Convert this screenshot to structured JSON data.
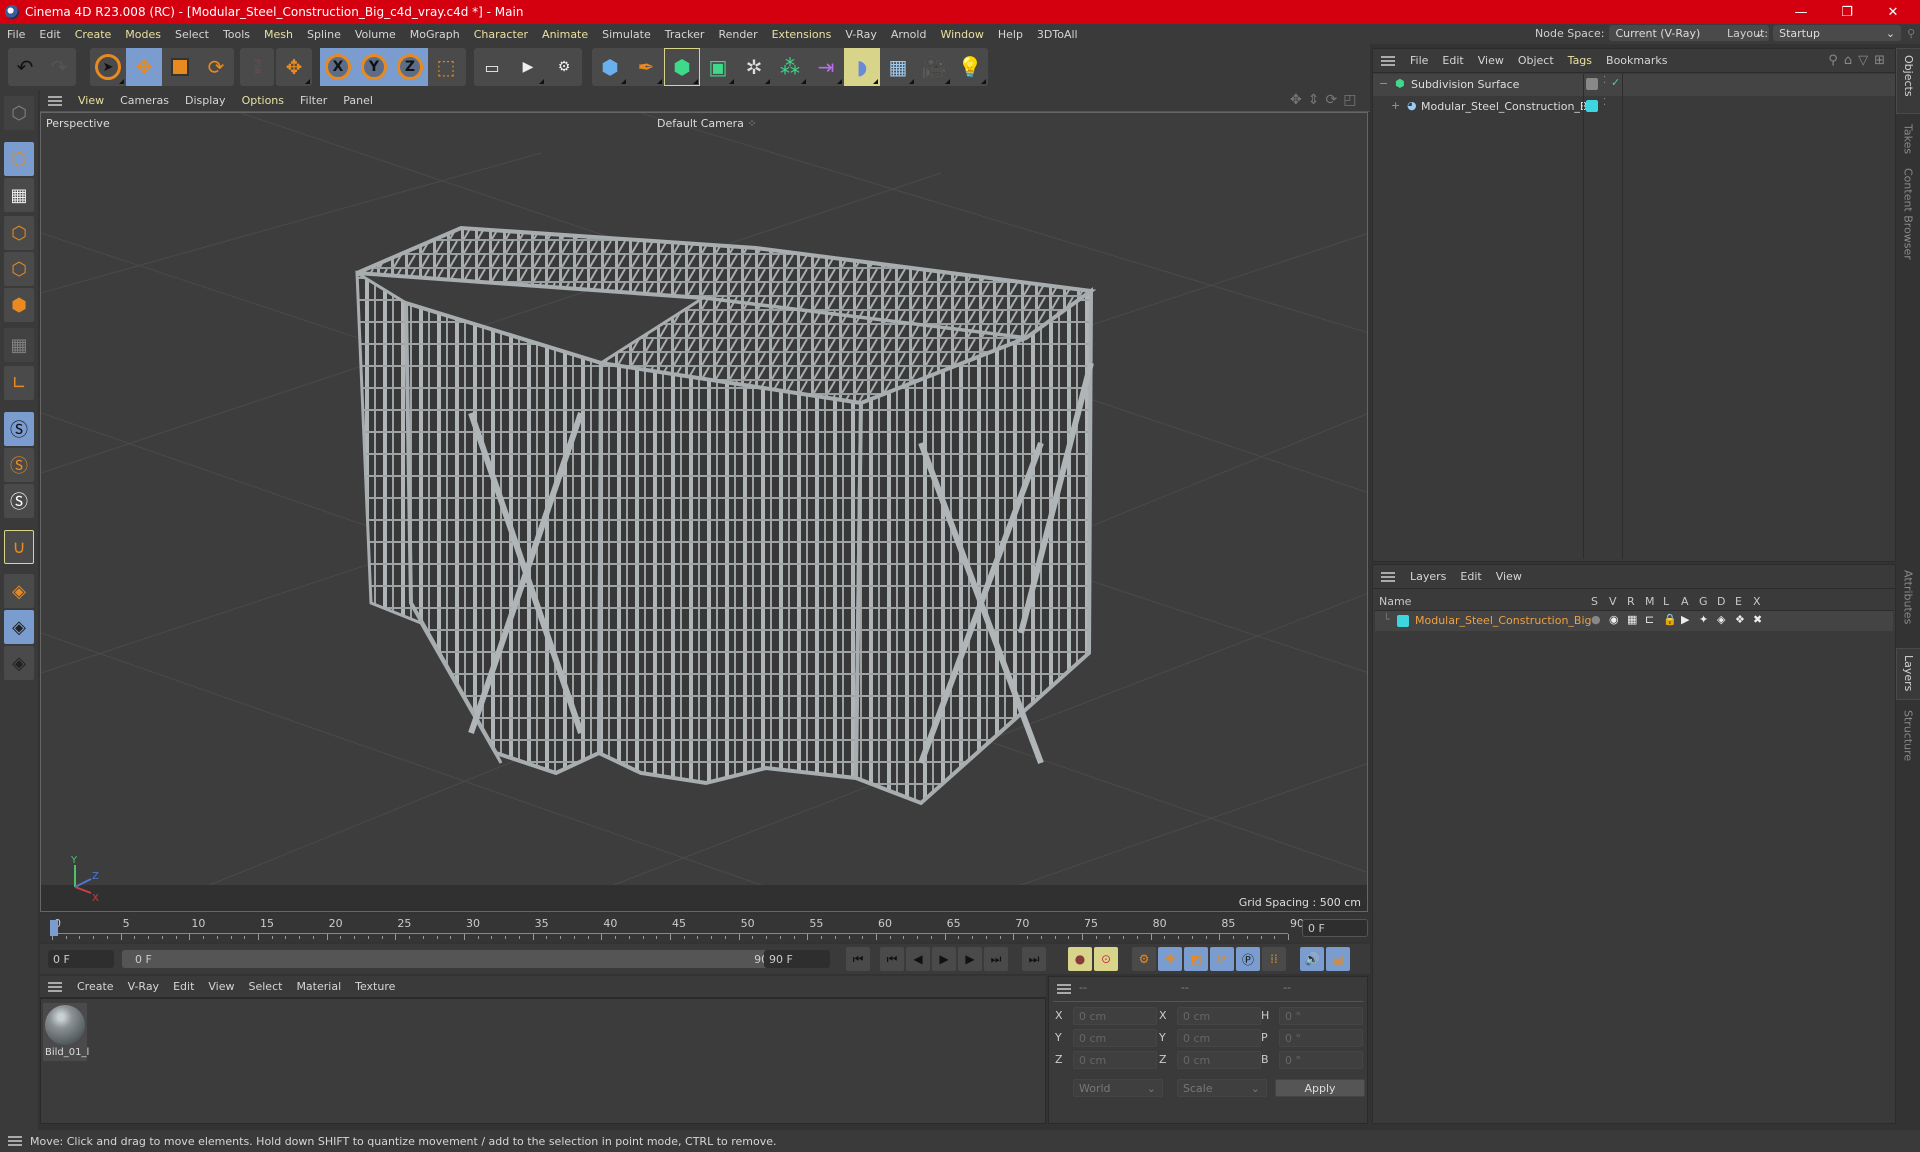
{
  "window": {
    "title": "Cinema 4D R23.008 (RC) - [Modular_Steel_Construction_Big_c4d_vray.c4d *] - Main",
    "controls": {
      "minimize": "—",
      "maximize": "❐",
      "close": "✕"
    }
  },
  "menubar": {
    "items": [
      {
        "label": "File",
        "hl": false
      },
      {
        "label": "Edit",
        "hl": false
      },
      {
        "label": "Create",
        "hl": true
      },
      {
        "label": "Modes",
        "hl": true
      },
      {
        "label": "Select",
        "hl": false
      },
      {
        "label": "Tools",
        "hl": false
      },
      {
        "label": "Mesh",
        "hl": true
      },
      {
        "label": "Spline",
        "hl": false
      },
      {
        "label": "Volume",
        "hl": false
      },
      {
        "label": "MoGraph",
        "hl": false
      },
      {
        "label": "Character",
        "hl": true
      },
      {
        "label": "Animate",
        "hl": true
      },
      {
        "label": "Simulate",
        "hl": false
      },
      {
        "label": "Tracker",
        "hl": false
      },
      {
        "label": "Render",
        "hl": false
      },
      {
        "label": "Extensions",
        "hl": true
      },
      {
        "label": "V-Ray",
        "hl": false
      },
      {
        "label": "Arnold",
        "hl": false
      },
      {
        "label": "Window",
        "hl": true
      },
      {
        "label": "Help",
        "hl": false
      },
      {
        "label": "3DToAll",
        "hl": false
      }
    ],
    "node_space_label": "Node Space:",
    "node_space_value": "Current (V-Ray)",
    "layout_label": "Layout:",
    "layout_value": "Startup"
  },
  "toolbar": {
    "undo": "undo",
    "redo": "redo",
    "axis_x": "X",
    "axis_y": "Y",
    "axis_z": "Z",
    "psr": "PSR"
  },
  "viewport": {
    "menu": [
      {
        "label": "View",
        "hl": true
      },
      {
        "label": "Cameras",
        "hl": false
      },
      {
        "label": "Display",
        "hl": false
      },
      {
        "label": "Options",
        "hl": true
      },
      {
        "label": "Filter",
        "hl": false
      },
      {
        "label": "Panel",
        "hl": false
      }
    ],
    "view_name": "Perspective",
    "camera": "Default Camera",
    "grid_spacing": "Grid Spacing : 500 cm",
    "axis": {
      "x": "X",
      "y": "Y",
      "z": "Z"
    }
  },
  "timeline": {
    "ticks": [
      "0",
      "5",
      "10",
      "15",
      "20",
      "25",
      "30",
      "35",
      "40",
      "45",
      "50",
      "55",
      "60",
      "65",
      "70",
      "75",
      "80",
      "85",
      "90"
    ],
    "current_frame_field": "0 F",
    "start_field": "0 F",
    "range_start": "0 F",
    "range_end": "90 F",
    "end_field": "90 F",
    "playhead_frame": 0,
    "max_frame": 90
  },
  "material_manager": {
    "menu": [
      "Create",
      "V-Ray",
      "Edit",
      "View",
      "Select",
      "Material",
      "Texture"
    ],
    "materials": [
      {
        "name": "Bild_01_l"
      }
    ]
  },
  "coordinates": {
    "headers": [
      "--",
      "--",
      "--"
    ],
    "rows": [
      {
        "l1": "X",
        "v1": "0 cm",
        "l2": "X",
        "v2": "0 cm",
        "l3": "H",
        "v3": "0 °"
      },
      {
        "l1": "Y",
        "v1": "0 cm",
        "l2": "Y",
        "v2": "0 cm",
        "l3": "P",
        "v3": "0 °"
      },
      {
        "l1": "Z",
        "v1": "0 cm",
        "l2": "Z",
        "v2": "0 cm",
        "l3": "B",
        "v3": "0 °"
      }
    ],
    "space": "World",
    "mode": "Scale",
    "apply": "Apply"
  },
  "objects_panel": {
    "menu": [
      {
        "label": "File",
        "hl": false
      },
      {
        "label": "Edit",
        "hl": false
      },
      {
        "label": "View",
        "hl": false
      },
      {
        "label": "Object",
        "hl": false
      },
      {
        "label": "Tags",
        "hl": true
      },
      {
        "label": "Bookmarks",
        "hl": false
      }
    ],
    "objects": [
      {
        "name": "Subdivision Surface",
        "expand": "−"
      },
      {
        "name": "Modular_Steel_Construction_Big",
        "expand": "+"
      }
    ]
  },
  "layers_panel": {
    "menu": [
      "Layers",
      "Edit",
      "View"
    ],
    "columns": [
      "Name",
      "S",
      "V",
      "R",
      "M",
      "L",
      "A",
      "G",
      "D",
      "E",
      "X"
    ],
    "layers": [
      {
        "name": "Modular_Steel_Construction_Big",
        "color": "#3dd6e0"
      }
    ]
  },
  "side_tabs": {
    "top": [
      "Objects",
      "Takes",
      "Content Browser"
    ],
    "bottom": [
      "Attributes",
      "Layers",
      "Structure"
    ]
  },
  "statusbar": {
    "text": "Move: Click and drag to move elements. Hold down SHIFT to quantize movement / add to the selection in point mode, CTRL to remove."
  },
  "colors": {
    "titlebar": "#d40010",
    "accent_orange": "#e88a20",
    "active_blue": "#7a9ccf",
    "highlight_yellow": "#d8d58a",
    "layer_cyan": "#3dd6e0",
    "layer_name_orange": "#f0a040"
  }
}
